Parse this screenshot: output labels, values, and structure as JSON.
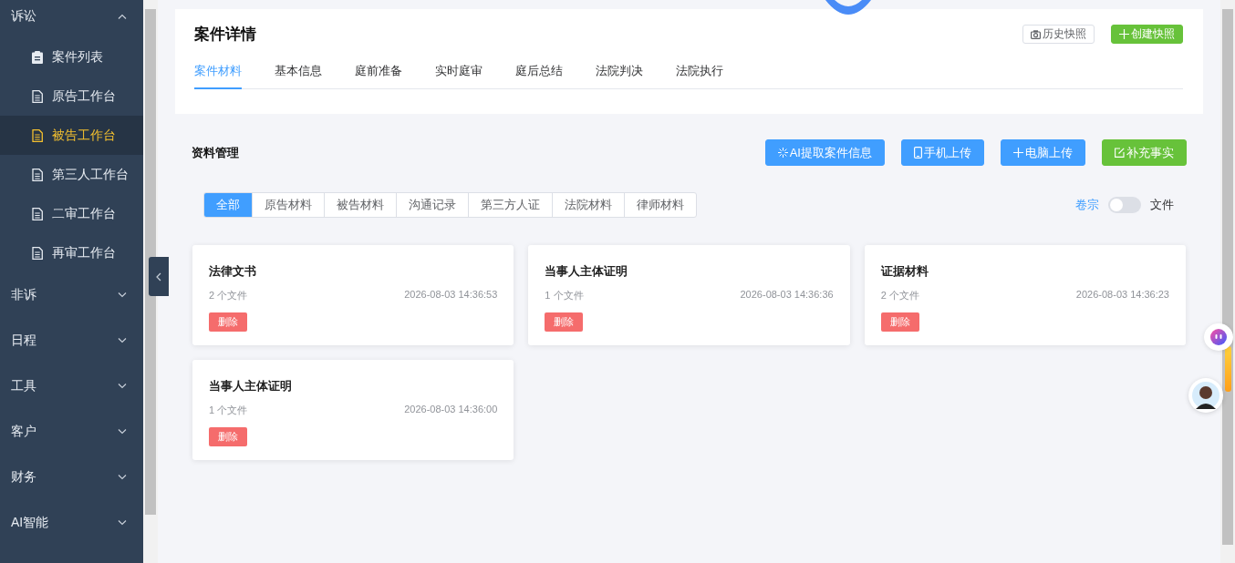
{
  "sidebar": {
    "groups": [
      {
        "label": "诉讼",
        "expanded": true,
        "children": [
          {
            "label": "案件列表",
            "kind": "clipboard",
            "selected": false
          },
          {
            "label": "原告工作台",
            "kind": "document",
            "selected": false
          },
          {
            "label": "被告工作台",
            "kind": "document",
            "selected": true
          },
          {
            "label": "第三人工作台",
            "kind": "document",
            "selected": false
          },
          {
            "label": "二审工作台",
            "kind": "document",
            "selected": false
          },
          {
            "label": "再审工作台",
            "kind": "document",
            "selected": false
          }
        ]
      },
      {
        "label": "非诉",
        "expanded": false
      },
      {
        "label": "日程",
        "expanded": false
      },
      {
        "label": "工具",
        "expanded": false
      },
      {
        "label": "客户",
        "expanded": false
      },
      {
        "label": "财务",
        "expanded": false
      },
      {
        "label": "AI智能",
        "expanded": false
      }
    ]
  },
  "case_header": {
    "title": "案件详情",
    "buttons": [
      {
        "label": "历史快照",
        "kind": "camera"
      },
      {
        "label": "创建快照",
        "kind": "plus"
      }
    ],
    "tabs": [
      {
        "label": "案件材料",
        "selected": true
      },
      {
        "label": "基本信息",
        "selected": false
      },
      {
        "label": "庭前准备",
        "selected": false
      },
      {
        "label": "实时庭审",
        "selected": false
      },
      {
        "label": "庭后总结",
        "selected": false
      },
      {
        "label": "法院判决",
        "selected": false
      },
      {
        "label": "法院执行",
        "selected": false
      }
    ]
  },
  "materials": {
    "title": "资料管理",
    "actions": [
      {
        "label": "AI提取案件信息",
        "kind": "sparkle"
      },
      {
        "label": "手机上传",
        "kind": "phone"
      },
      {
        "label": "电脑上传",
        "kind": "plus"
      },
      {
        "label": "补充事实",
        "kind": "edit"
      }
    ],
    "filters": [
      {
        "label": "全部",
        "selected": true
      },
      {
        "label": "原告材料",
        "selected": false
      },
      {
        "label": "被告材料",
        "selected": false
      },
      {
        "label": "沟通记录",
        "selected": false
      },
      {
        "label": "第三方人证",
        "selected": false
      },
      {
        "label": "法院材料",
        "selected": false
      },
      {
        "label": "律师材料",
        "selected": false
      }
    ],
    "view_toggle": {
      "left_label": "卷宗",
      "right_label": "文件",
      "on": false
    },
    "cards": [
      {
        "title": "法律文书",
        "count": "2 个文件",
        "time": "2026-08-03 14:36:53",
        "delete_label": "删除"
      },
      {
        "title": "当事人主体证明",
        "count": "1 个文件",
        "time": "2026-08-03 14:36:36",
        "delete_label": "删除"
      },
      {
        "title": "证据材料",
        "count": "2 个文件",
        "time": "2026-08-03 14:36:23",
        "delete_label": "删除"
      },
      {
        "title": "当事人主体证明",
        "count": "1 个文件",
        "time": "2026-08-03 14:36:00",
        "delete_label": "删除"
      }
    ]
  }
}
